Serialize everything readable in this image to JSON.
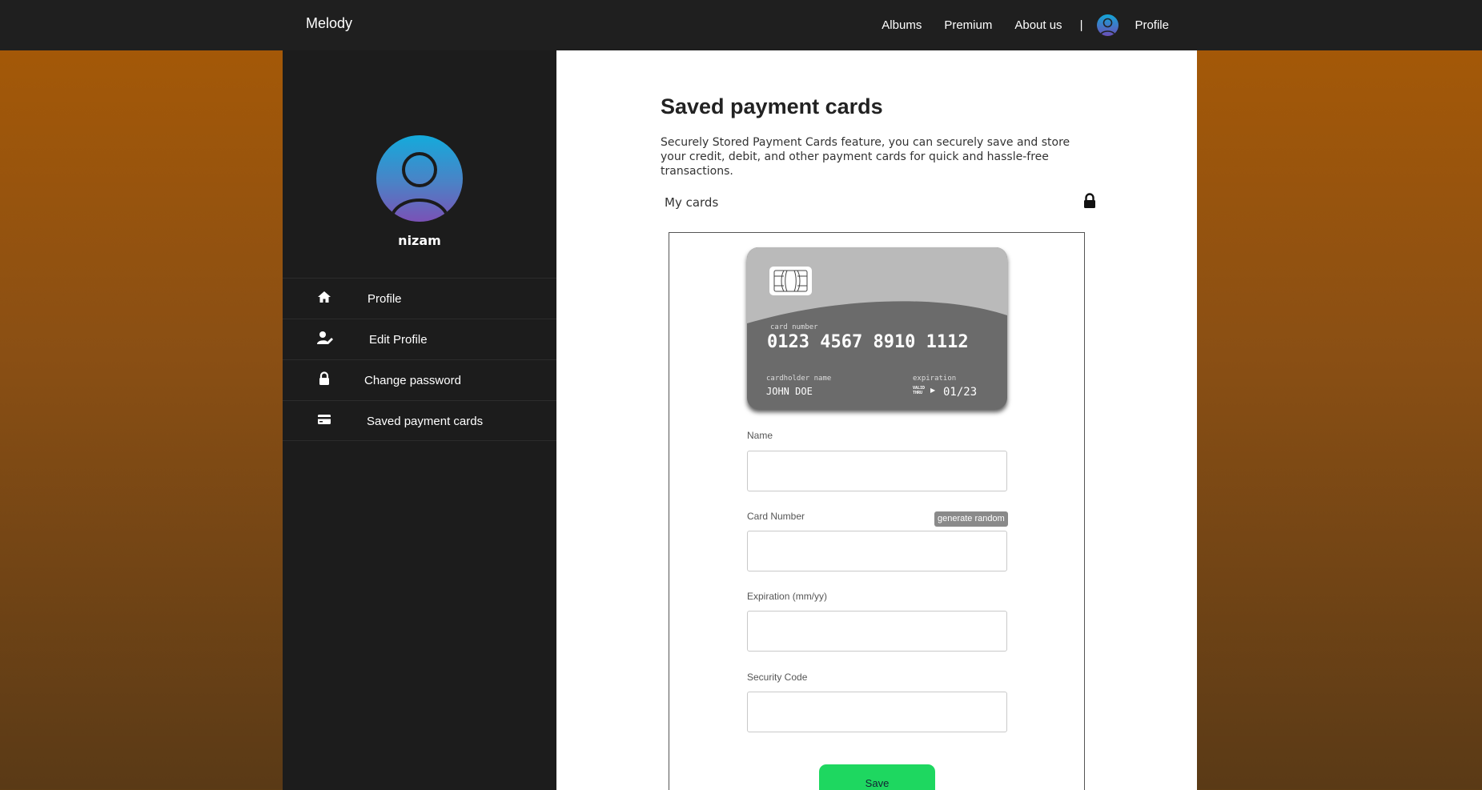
{
  "nav": {
    "brand": "Melody",
    "links": [
      "Albums",
      "Premium",
      "About us"
    ],
    "separator": "|",
    "profile_label": "Profile"
  },
  "sidebar": {
    "username": "nizam",
    "items": [
      {
        "label": "Profile",
        "icon": "home-icon"
      },
      {
        "label": "Edit Profile",
        "icon": "user-edit-icon"
      },
      {
        "label": "Change password",
        "icon": "lock-icon"
      },
      {
        "label": "Saved payment cards",
        "icon": "credit-card-icon"
      }
    ]
  },
  "main": {
    "title": "Saved payment cards",
    "description": "Securely Stored Payment Cards feature, you can securely save and store your credit, debit, and other payment cards for quick and hassle-free transactions.",
    "my_cards_label": "My cards"
  },
  "card": {
    "number_label": "card number",
    "number": "0123 4567 8910 1112",
    "holder_label": "cardholder name",
    "holder": "JOHN DOE",
    "expiration_label": "expiration",
    "valid_thru_1": "VALID",
    "valid_thru_2": "THRU",
    "expiration": "01/23"
  },
  "form": {
    "name_label": "Name",
    "name_value": "",
    "card_number_label": "Card Number",
    "card_number_value": "",
    "generate_label": "generate random",
    "expiration_label": "Expiration (mm/yy)",
    "expiration_value": "",
    "security_label": "Security Code",
    "security_value": "",
    "save_label": "Save"
  },
  "colors": {
    "accent_green": "#1ed760",
    "nav_bg": "#1f1f1f",
    "sidebar_bg": "#1c1c1c"
  }
}
